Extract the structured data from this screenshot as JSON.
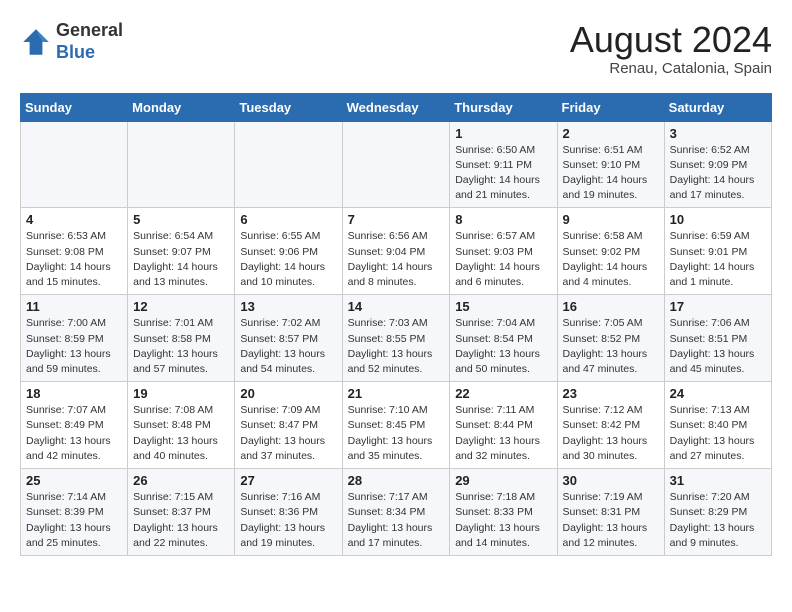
{
  "header": {
    "logo_general": "General",
    "logo_blue": "Blue",
    "month_year": "August 2024",
    "location": "Renau, Catalonia, Spain"
  },
  "days_of_week": [
    "Sunday",
    "Monday",
    "Tuesday",
    "Wednesday",
    "Thursday",
    "Friday",
    "Saturday"
  ],
  "weeks": [
    [
      {
        "day": "",
        "info": ""
      },
      {
        "day": "",
        "info": ""
      },
      {
        "day": "",
        "info": ""
      },
      {
        "day": "",
        "info": ""
      },
      {
        "day": "1",
        "info": "Sunrise: 6:50 AM\nSunset: 9:11 PM\nDaylight: 14 hours\nand 21 minutes."
      },
      {
        "day": "2",
        "info": "Sunrise: 6:51 AM\nSunset: 9:10 PM\nDaylight: 14 hours\nand 19 minutes."
      },
      {
        "day": "3",
        "info": "Sunrise: 6:52 AM\nSunset: 9:09 PM\nDaylight: 14 hours\nand 17 minutes."
      }
    ],
    [
      {
        "day": "4",
        "info": "Sunrise: 6:53 AM\nSunset: 9:08 PM\nDaylight: 14 hours\nand 15 minutes."
      },
      {
        "day": "5",
        "info": "Sunrise: 6:54 AM\nSunset: 9:07 PM\nDaylight: 14 hours\nand 13 minutes."
      },
      {
        "day": "6",
        "info": "Sunrise: 6:55 AM\nSunset: 9:06 PM\nDaylight: 14 hours\nand 10 minutes."
      },
      {
        "day": "7",
        "info": "Sunrise: 6:56 AM\nSunset: 9:04 PM\nDaylight: 14 hours\nand 8 minutes."
      },
      {
        "day": "8",
        "info": "Sunrise: 6:57 AM\nSunset: 9:03 PM\nDaylight: 14 hours\nand 6 minutes."
      },
      {
        "day": "9",
        "info": "Sunrise: 6:58 AM\nSunset: 9:02 PM\nDaylight: 14 hours\nand 4 minutes."
      },
      {
        "day": "10",
        "info": "Sunrise: 6:59 AM\nSunset: 9:01 PM\nDaylight: 14 hours\nand 1 minute."
      }
    ],
    [
      {
        "day": "11",
        "info": "Sunrise: 7:00 AM\nSunset: 8:59 PM\nDaylight: 13 hours\nand 59 minutes."
      },
      {
        "day": "12",
        "info": "Sunrise: 7:01 AM\nSunset: 8:58 PM\nDaylight: 13 hours\nand 57 minutes."
      },
      {
        "day": "13",
        "info": "Sunrise: 7:02 AM\nSunset: 8:57 PM\nDaylight: 13 hours\nand 54 minutes."
      },
      {
        "day": "14",
        "info": "Sunrise: 7:03 AM\nSunset: 8:55 PM\nDaylight: 13 hours\nand 52 minutes."
      },
      {
        "day": "15",
        "info": "Sunrise: 7:04 AM\nSunset: 8:54 PM\nDaylight: 13 hours\nand 50 minutes."
      },
      {
        "day": "16",
        "info": "Sunrise: 7:05 AM\nSunset: 8:52 PM\nDaylight: 13 hours\nand 47 minutes."
      },
      {
        "day": "17",
        "info": "Sunrise: 7:06 AM\nSunset: 8:51 PM\nDaylight: 13 hours\nand 45 minutes."
      }
    ],
    [
      {
        "day": "18",
        "info": "Sunrise: 7:07 AM\nSunset: 8:49 PM\nDaylight: 13 hours\nand 42 minutes."
      },
      {
        "day": "19",
        "info": "Sunrise: 7:08 AM\nSunset: 8:48 PM\nDaylight: 13 hours\nand 40 minutes."
      },
      {
        "day": "20",
        "info": "Sunrise: 7:09 AM\nSunset: 8:47 PM\nDaylight: 13 hours\nand 37 minutes."
      },
      {
        "day": "21",
        "info": "Sunrise: 7:10 AM\nSunset: 8:45 PM\nDaylight: 13 hours\nand 35 minutes."
      },
      {
        "day": "22",
        "info": "Sunrise: 7:11 AM\nSunset: 8:44 PM\nDaylight: 13 hours\nand 32 minutes."
      },
      {
        "day": "23",
        "info": "Sunrise: 7:12 AM\nSunset: 8:42 PM\nDaylight: 13 hours\nand 30 minutes."
      },
      {
        "day": "24",
        "info": "Sunrise: 7:13 AM\nSunset: 8:40 PM\nDaylight: 13 hours\nand 27 minutes."
      }
    ],
    [
      {
        "day": "25",
        "info": "Sunrise: 7:14 AM\nSunset: 8:39 PM\nDaylight: 13 hours\nand 25 minutes."
      },
      {
        "day": "26",
        "info": "Sunrise: 7:15 AM\nSunset: 8:37 PM\nDaylight: 13 hours\nand 22 minutes."
      },
      {
        "day": "27",
        "info": "Sunrise: 7:16 AM\nSunset: 8:36 PM\nDaylight: 13 hours\nand 19 minutes."
      },
      {
        "day": "28",
        "info": "Sunrise: 7:17 AM\nSunset: 8:34 PM\nDaylight: 13 hours\nand 17 minutes."
      },
      {
        "day": "29",
        "info": "Sunrise: 7:18 AM\nSunset: 8:33 PM\nDaylight: 13 hours\nand 14 minutes."
      },
      {
        "day": "30",
        "info": "Sunrise: 7:19 AM\nSunset: 8:31 PM\nDaylight: 13 hours\nand 12 minutes."
      },
      {
        "day": "31",
        "info": "Sunrise: 7:20 AM\nSunset: 8:29 PM\nDaylight: 13 hours\nand 9 minutes."
      }
    ]
  ]
}
